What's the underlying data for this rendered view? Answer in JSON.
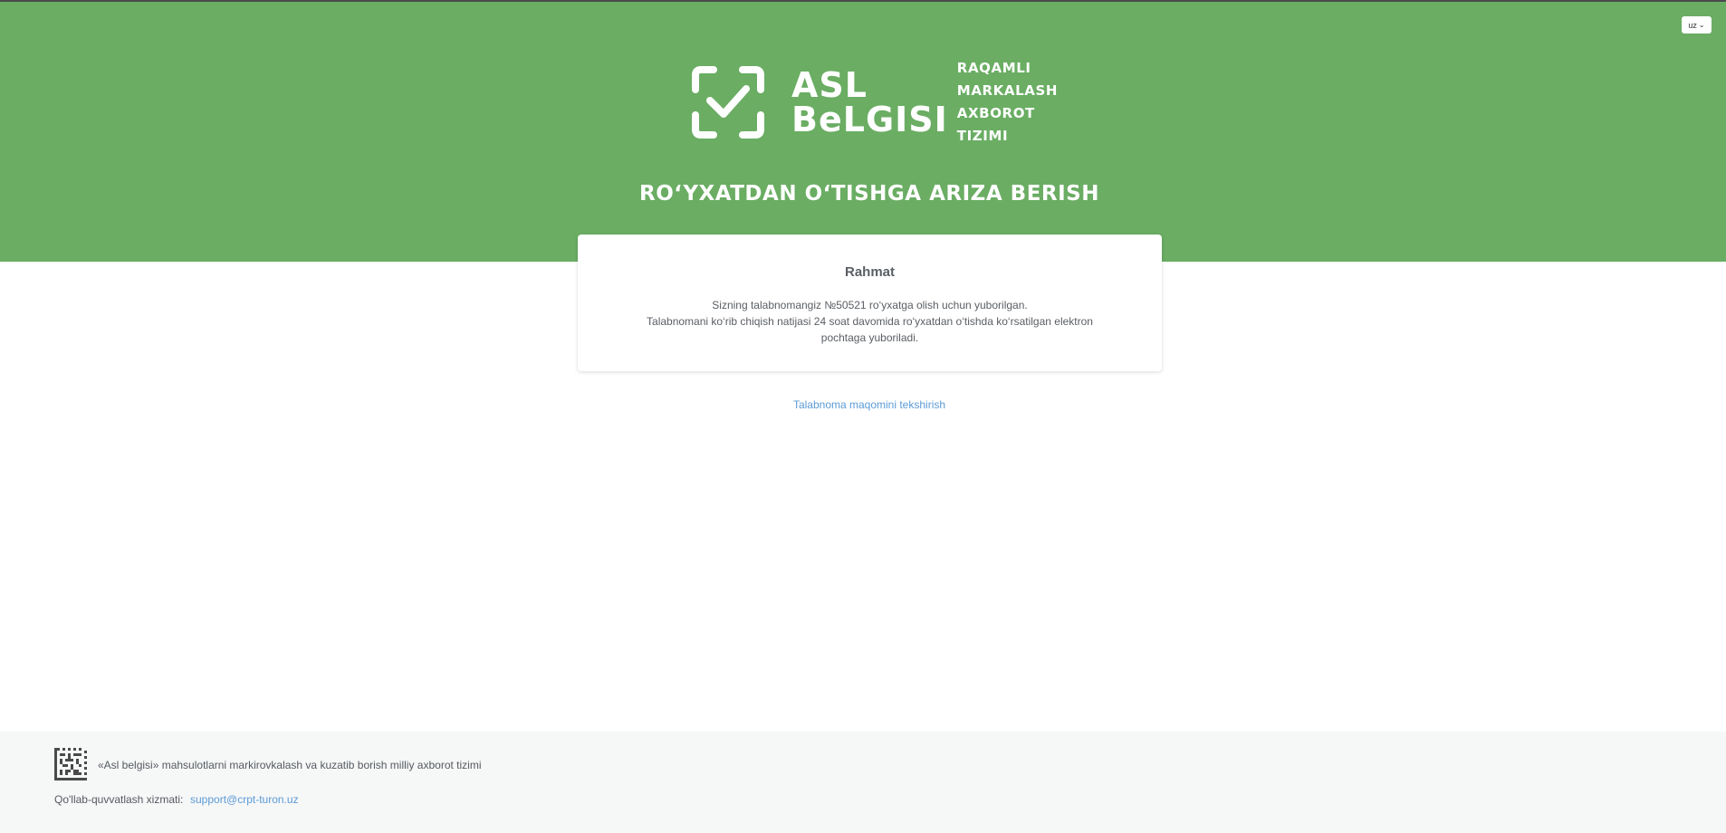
{
  "header": {
    "language": "uz",
    "logo": {
      "name_line1": "ASL",
      "name_line2": "BeLGISI",
      "tagline": [
        "RAQAMLI",
        "MARKALASH",
        "AXBOROT TIZIMI"
      ]
    },
    "title": "RO‘YXATDAN O‘TISHGA ARIZA BERISH"
  },
  "card": {
    "title": "Rahmat",
    "line1": "Sizning talabnomangiz №50521 ro‘yxatga olish uchun yuborilgan.",
    "line2": "Talabnomani ko‘rib chiqish natijasi 24 soat davomida ro‘yxatdan o‘tishda ko‘rsatilgan elektron pochtaga yuboriladi."
  },
  "status_link": "Talabnoma maqomini tekshirish",
  "footer": {
    "description": "«Asl belgisi» mahsulotlarni markirovkalash va kuzatib borish milliy axborot tizimi",
    "support_label": "Qo'llab-quvvatlash xizmati:",
    "support_email": "support@crpt-turon.uz"
  },
  "colors": {
    "brand_green": "#6aad63",
    "link_blue": "#5b9bd5",
    "footer_bg": "#f6f7f7"
  },
  "icons": {
    "logo": "check-frame-icon",
    "language": "chevron-down-icon",
    "footer": "datamatrix-code-icon"
  }
}
